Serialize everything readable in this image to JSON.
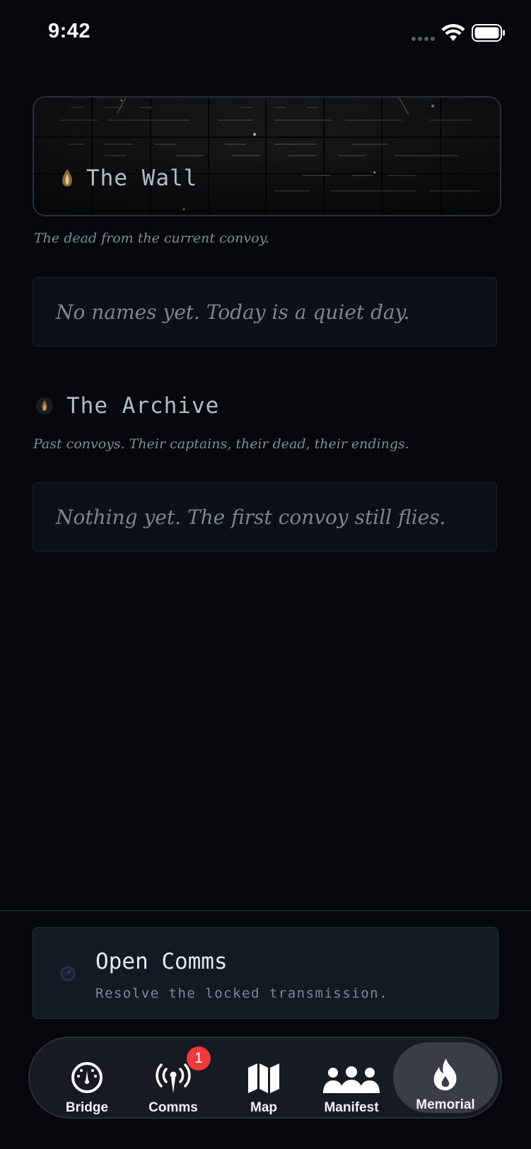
{
  "status_bar": {
    "time": "9:42"
  },
  "wall": {
    "title": "The Wall",
    "subtitle": "The dead from the current convoy.",
    "empty_message": "No names yet. Today is a quiet day."
  },
  "archive": {
    "title": "The Archive",
    "subtitle": "Past convoys. Their captains, their dead, their endings.",
    "empty_message": "Nothing yet. The first convoy still flies."
  },
  "task_card": {
    "title": "Open Comms",
    "subtitle": "Resolve the locked transmission."
  },
  "tabs": [
    {
      "label": "Bridge",
      "icon": "gauge-icon",
      "active": false
    },
    {
      "label": "Comms",
      "icon": "antenna-icon",
      "active": false,
      "badge": "1"
    },
    {
      "label": "Map",
      "icon": "map-icon",
      "active": false
    },
    {
      "label": "Manifest",
      "icon": "people-icon",
      "active": false
    },
    {
      "label": "Memorial",
      "icon": "flame-icon",
      "active": true
    }
  ],
  "colors": {
    "background": "#05070d",
    "badge": "#f0393b",
    "candle_glow": "#c8a060"
  }
}
